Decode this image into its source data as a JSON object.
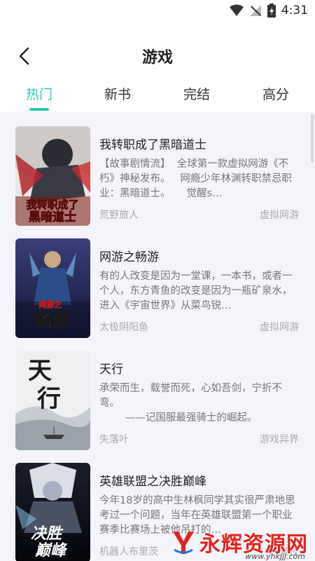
{
  "status": {
    "time": "4:31"
  },
  "header": {
    "title": "游戏"
  },
  "tabs": [
    {
      "label": "热门",
      "active": true
    },
    {
      "label": "新书",
      "active": false
    },
    {
      "label": "完结",
      "active": false
    },
    {
      "label": "高分",
      "active": false
    }
  ],
  "books": [
    {
      "title": "我转职成了黑暗道士",
      "desc": "【故事剧情流】  全球第一款虚拟网游《不朽》神秘发布。   网瘾少年林渊转职禁忌职业：黑暗道士。     觉醒s…",
      "author": "荒野旅人",
      "genre": "虚拟网游",
      "cover_text": [
        "我转职成了",
        "黑暗道士"
      ]
    },
    {
      "title": "网游之畅游",
      "desc": "有的人改变是因为一堂课，一本书，或者一个人，东方青鱼的改变是因为一瓶矿泉水，进入《宇宙世界》从菜鸟锐…",
      "author": "太极阴阳鱼",
      "genre": "虚拟网游",
      "cover_text": [
        "网游之",
        "畅游"
      ]
    },
    {
      "title": "天行",
      "desc": "承荣而生，载誉而死，心如吾剑，宁折不弯。\n        ——记国服最强骑士的崛起。",
      "author": "失落叶",
      "genre": "游戏异界",
      "cover_text": [
        "天",
        "行"
      ]
    },
    {
      "title": "英雄联盟之决胜巅峰",
      "desc": "今年18岁的高中生林枫同学其实很严肃地思考过一个问题，当年在英雄联盟第一个职业赛季比赛场上被他吊打的…",
      "author": "机器人布里茨",
      "genre": "竞技",
      "cover_text": [
        "决胜",
        "巅峰"
      ]
    }
  ],
  "watermark": {
    "text": "永辉资源网",
    "url": "www.yhkjjj.com"
  },
  "colors": {
    "accent": "#2fc7b1",
    "list_bg": "#f5f4fa"
  }
}
